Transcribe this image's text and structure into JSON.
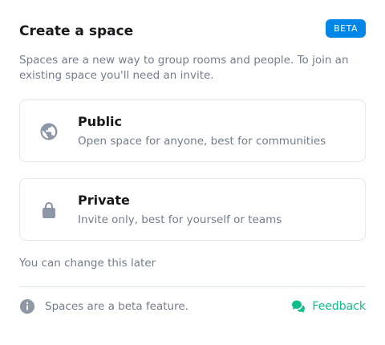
{
  "dialog": {
    "title": "Create a space",
    "beta_badge": "BETA",
    "description": "Spaces are a new way to group rooms and people. To join an existing space you'll need an invite.",
    "options": [
      {
        "title": "Public",
        "description": "Open space for anyone, best for communities",
        "icon": "globe-icon"
      },
      {
        "title": "Private",
        "description": "Invite only, best for yourself or teams",
        "icon": "lock-icon"
      }
    ],
    "change_later": "You can change this later",
    "footer": {
      "info_text": "Spaces are a beta feature.",
      "feedback_label": "Feedback"
    }
  },
  "colors": {
    "accent": "#0dbd8b",
    "beta_badge": "#0086e6",
    "muted_text": "#737d8c",
    "icon": "#8d97a5",
    "border": "#e3e8f0"
  }
}
